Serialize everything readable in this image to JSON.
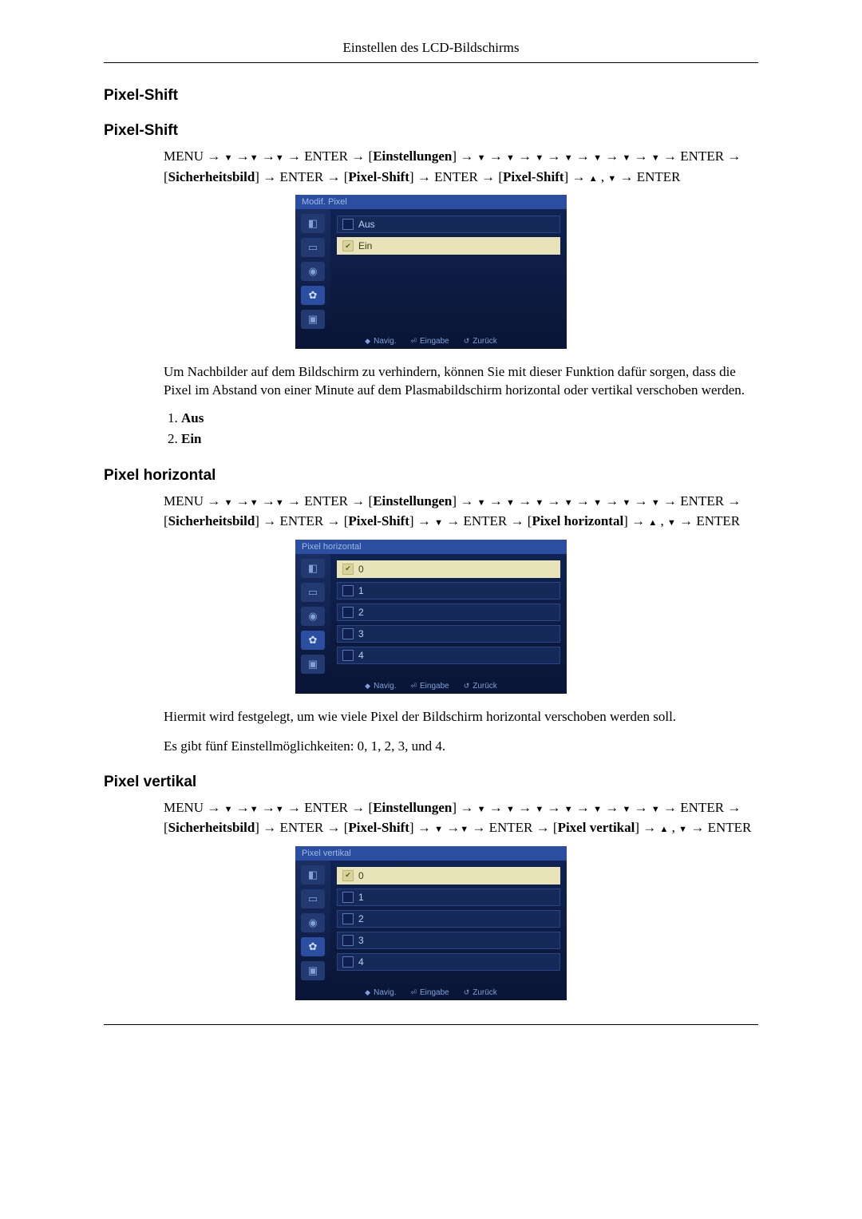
{
  "header": "Einstellen des LCD-Bildschirms",
  "sections": {
    "pixel_shift": {
      "h1": "Pixel-Shift",
      "h2": "Pixel-Shift",
      "nav_prefix": "MENU",
      "nav_enter": "ENTER",
      "nav_einst": "Einstellungen",
      "nav_sich": "Sicherheitsbild",
      "nav_ps": "Pixel-Shift",
      "osd_title": "Modif. Pixel",
      "osd_items": [
        "Aus",
        "Ein"
      ],
      "desc": "Um Nachbilder auf dem Bildschirm zu verhindern, können Sie mit dieser Funktion dafür sorgen, dass die Pixel im Abstand von einer Minute auf dem Plasmabildschirm horizontal oder vertikal verschoben werden.",
      "opts": [
        "Aus",
        "Ein"
      ]
    },
    "pixel_horizontal": {
      "h": "Pixel horizontal",
      "nav_ph": "Pixel horizontal",
      "osd_title": "Pixel horizontal",
      "osd_items": [
        "0",
        "1",
        "2",
        "3",
        "4"
      ],
      "desc1": "Hiermit wird festgelegt, um wie viele Pixel der Bildschirm horizontal verschoben werden soll.",
      "desc2": "Es gibt fünf Einstellmöglichkeiten: 0, 1, 2, 3, und 4."
    },
    "pixel_vertikal": {
      "h": "Pixel vertikal",
      "nav_pv": "Pixel vertikal",
      "osd_title": "Pixel vertikal",
      "osd_items": [
        "0",
        "1",
        "2",
        "3",
        "4"
      ]
    }
  },
  "osd_footer": {
    "nav": "Navig.",
    "enter": "Eingabe",
    "back": "Zurück"
  },
  "icons": [
    "picture-icon",
    "screen-icon",
    "sound-icon",
    "setup-icon",
    "multi-icon"
  ]
}
